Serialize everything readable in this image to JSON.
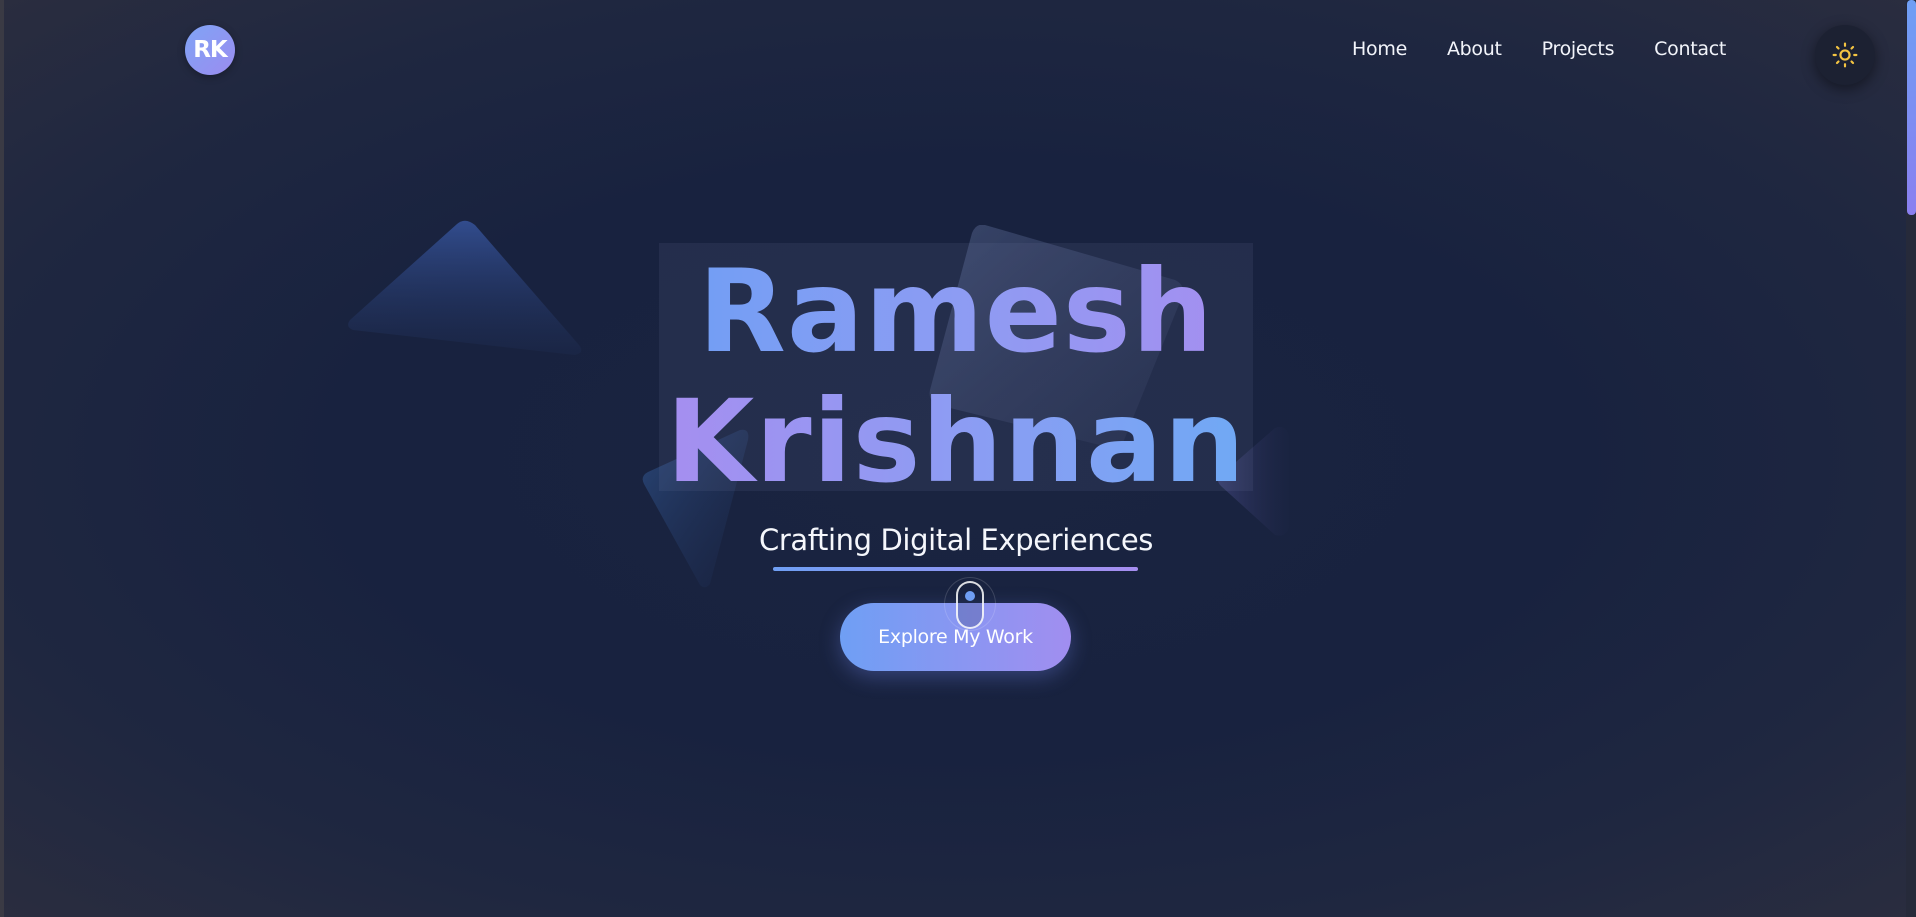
{
  "header": {
    "logo_text": "RK",
    "nav_items": [
      {
        "label": "Home"
      },
      {
        "label": "About"
      },
      {
        "label": "Projects"
      },
      {
        "label": "Contact"
      }
    ],
    "theme_toggle_icon": "sun-icon"
  },
  "hero": {
    "first_name": "Ramesh",
    "last_name": "Krishnan",
    "tagline": "Crafting Digital Experiences",
    "cta_label": "Explore My Work",
    "scroll_indicator_icon": "mouse-scroll-icon"
  },
  "colors": {
    "background": "#18223f",
    "accent_blue": "#6f9ff4",
    "accent_purple": "#a68ef0",
    "sun": "#f5c542"
  }
}
